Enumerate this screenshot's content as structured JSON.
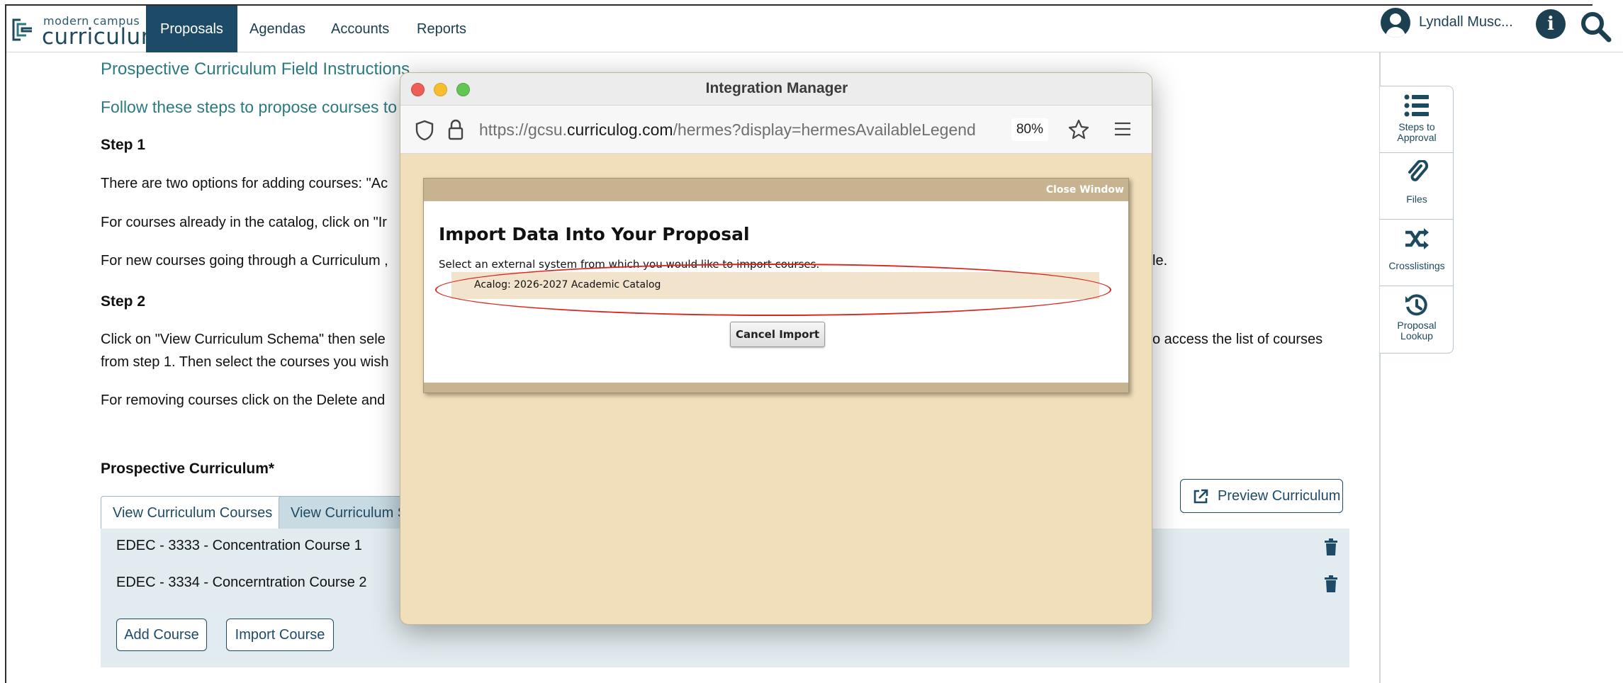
{
  "brand": {
    "small": "modern campus",
    "big": "curriculum"
  },
  "nav": {
    "items": [
      "Proposals",
      "Agendas",
      "Accounts",
      "Reports"
    ],
    "active": "Proposals"
  },
  "user": {
    "name": "Lyndall Musc..."
  },
  "main": {
    "title": "Prospective Curriculum Field Instructions",
    "subtitle": "Follow these steps to propose courses to t",
    "step1_heading": "Step 1",
    "step1_p1": "There are two options for adding courses: \"Ac",
    "step1_p2": "For courses already in the catalog, click on \"Ir",
    "step1_p3": "For new courses going through a Curriculum ,",
    "step1_p3_tail": "le.",
    "step2_heading": "Step 2",
    "step2_p1a": "Click on \"View Curriculum Schema\" then sele",
    "step2_p1b": "from step 1. Then select the courses you wish",
    "step2_p1_tail": "o access the list of courses",
    "step2_p2": "For removing courses click on the Delete and",
    "curriculum_heading": "Prospective Curriculum*"
  },
  "tabs": [
    "View Curriculum Courses",
    "View Curriculum Sc"
  ],
  "preview_button": "Preview Curriculum",
  "courses": [
    "EDEC - 3333 - Concentration Course 1",
    "EDEC - 3334 - Concerntration Course 2"
  ],
  "buttons": {
    "add_course": "Add Course",
    "import_course": "Import Course"
  },
  "sidebar": [
    {
      "label": "Steps to Approval",
      "icon": "list-icon"
    },
    {
      "label": "Files",
      "icon": "paperclip-icon"
    },
    {
      "label": "Crosslistings",
      "icon": "shuffle-icon"
    },
    {
      "label": "Proposal Lookup",
      "icon": "history-icon"
    }
  ],
  "window": {
    "title": "Integration Manager",
    "url_prefix": "https://gcsu.",
    "url_domain": "curriculog.com",
    "url_path": "/hermes?display=hermesAvailableLegend",
    "zoom": "80%"
  },
  "dialog": {
    "close": "Close Window",
    "title": "Import Data Into Your Proposal",
    "subtitle": "Select an external system from which you would like to import courses.",
    "option": "Acalog: 2026-2027 Academic Catalog",
    "cancel": "Cancel Import"
  },
  "colors": {
    "nav_active": "#1d4a67",
    "teal": "#2a7a7f",
    "window_bg": "#f1deba",
    "highlight": "#d9251d"
  }
}
